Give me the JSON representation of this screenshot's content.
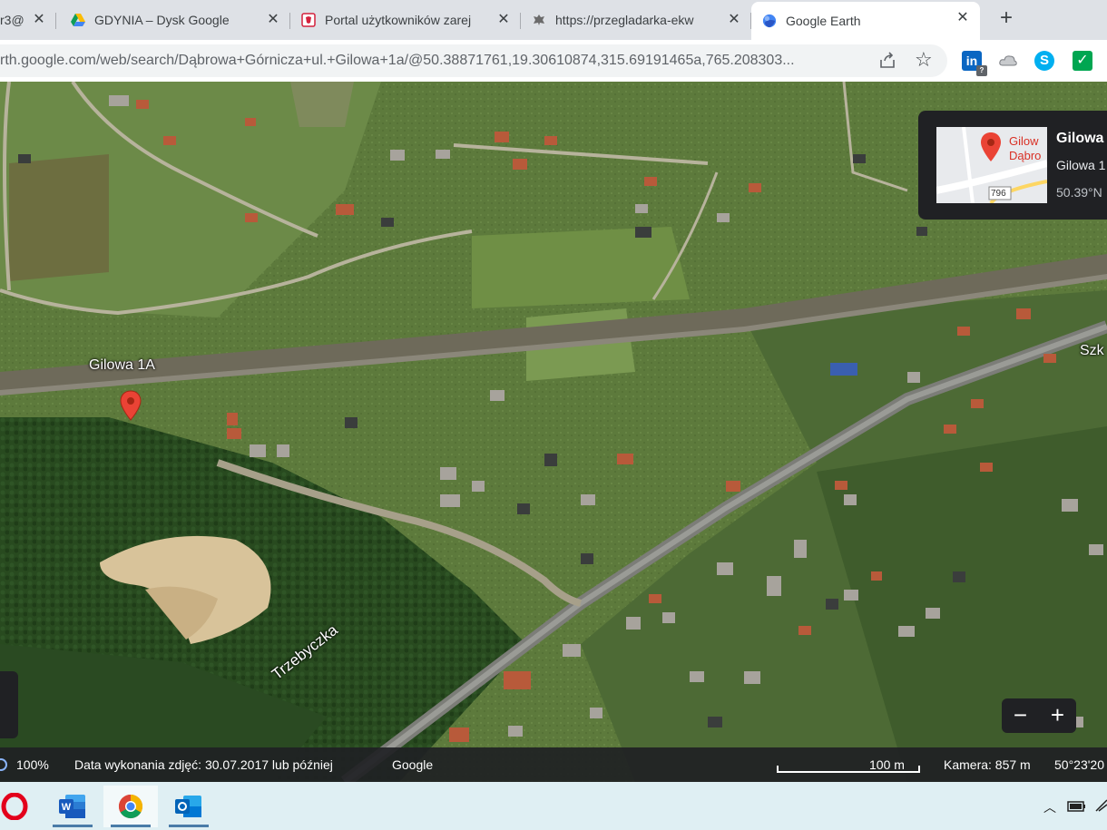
{
  "browser": {
    "tabs": [
      {
        "title": "r3@",
        "favicon": "mail-icon"
      },
      {
        "title": "GDYNIA – Dysk Google",
        "favicon": "google-drive-icon"
      },
      {
        "title": "Portal użytkowników zarej",
        "favicon": "poland-emblem-icon"
      },
      {
        "title": "https://przegladarka-ekw",
        "favicon": "eagle-emblem-icon"
      },
      {
        "title": "Google Earth",
        "favicon": "google-earth-icon",
        "active": true
      }
    ],
    "new_tab_symbol": "+",
    "close_symbol": "✕",
    "url_prefix": "rth.google.com",
    "url_path": "/web/search/Dąbrowa+Górnicza+ul.+Gilowa+1a/@50.38871761,19.30610874,315.69191465a,765.208303...",
    "extensions": {
      "linkedin": "in",
      "linkedin_badge": "?",
      "skype": "S",
      "check": "✓"
    }
  },
  "map": {
    "pin_label": "Gilowa 1A",
    "street_label": "Trzebyczka",
    "partial_label": "Szk",
    "info_card": {
      "title": "Gilowa",
      "subtitle": "Gilowa 1",
      "coords": "50.39°N",
      "thumb_text_1": "Gilow",
      "thumb_text_2": "Dąbro",
      "road_number": "796"
    },
    "zoom": {
      "minus": "−",
      "plus": "+"
    }
  },
  "status_bar": {
    "zoom_percent": "100%",
    "capture_date": "Data wykonania zdjęć: 30.07.2017 lub później",
    "attribution": "Google",
    "scale_label": "100 m",
    "camera": "Kamera: 857 m",
    "coords": "50°23'20"
  },
  "colors": {
    "tab_strip": "#dee1e6",
    "earth_panel": "#202124",
    "pin_red": "#ea4335",
    "taskbar": "#dfeff3"
  }
}
